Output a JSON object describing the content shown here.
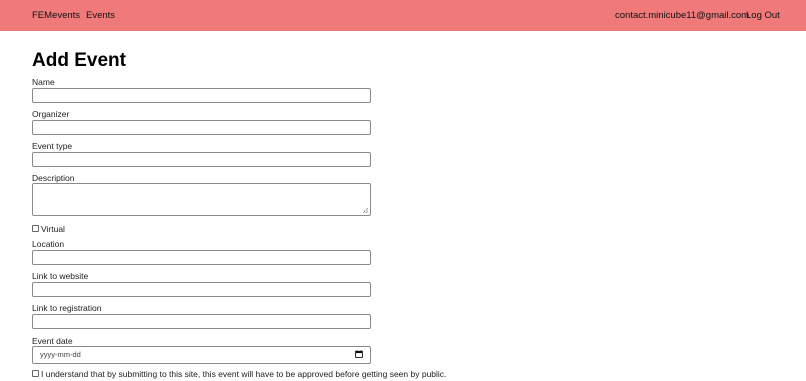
{
  "navbar": {
    "brand": "FEMevents",
    "events_link": "Events",
    "user_email": "contact.minicube11@gmail.com",
    "logout_link": "Log Out",
    "background_color": "#f07a7a"
  },
  "form": {
    "title": "Add Event",
    "name_label": "Name",
    "organizer_label": "Organizer",
    "event_type_label": "Event type",
    "description_label": "Description",
    "virtual_label": "Virtual",
    "location_label": "Location",
    "website_label": "Link to website",
    "registration_label": "Link to registration",
    "event_date_label": "Event date",
    "event_date_placeholder": "yyyy-mm-dd",
    "consent_label": "I understand that by submitting to this site, this event will have to be approved before getting seen by public."
  }
}
